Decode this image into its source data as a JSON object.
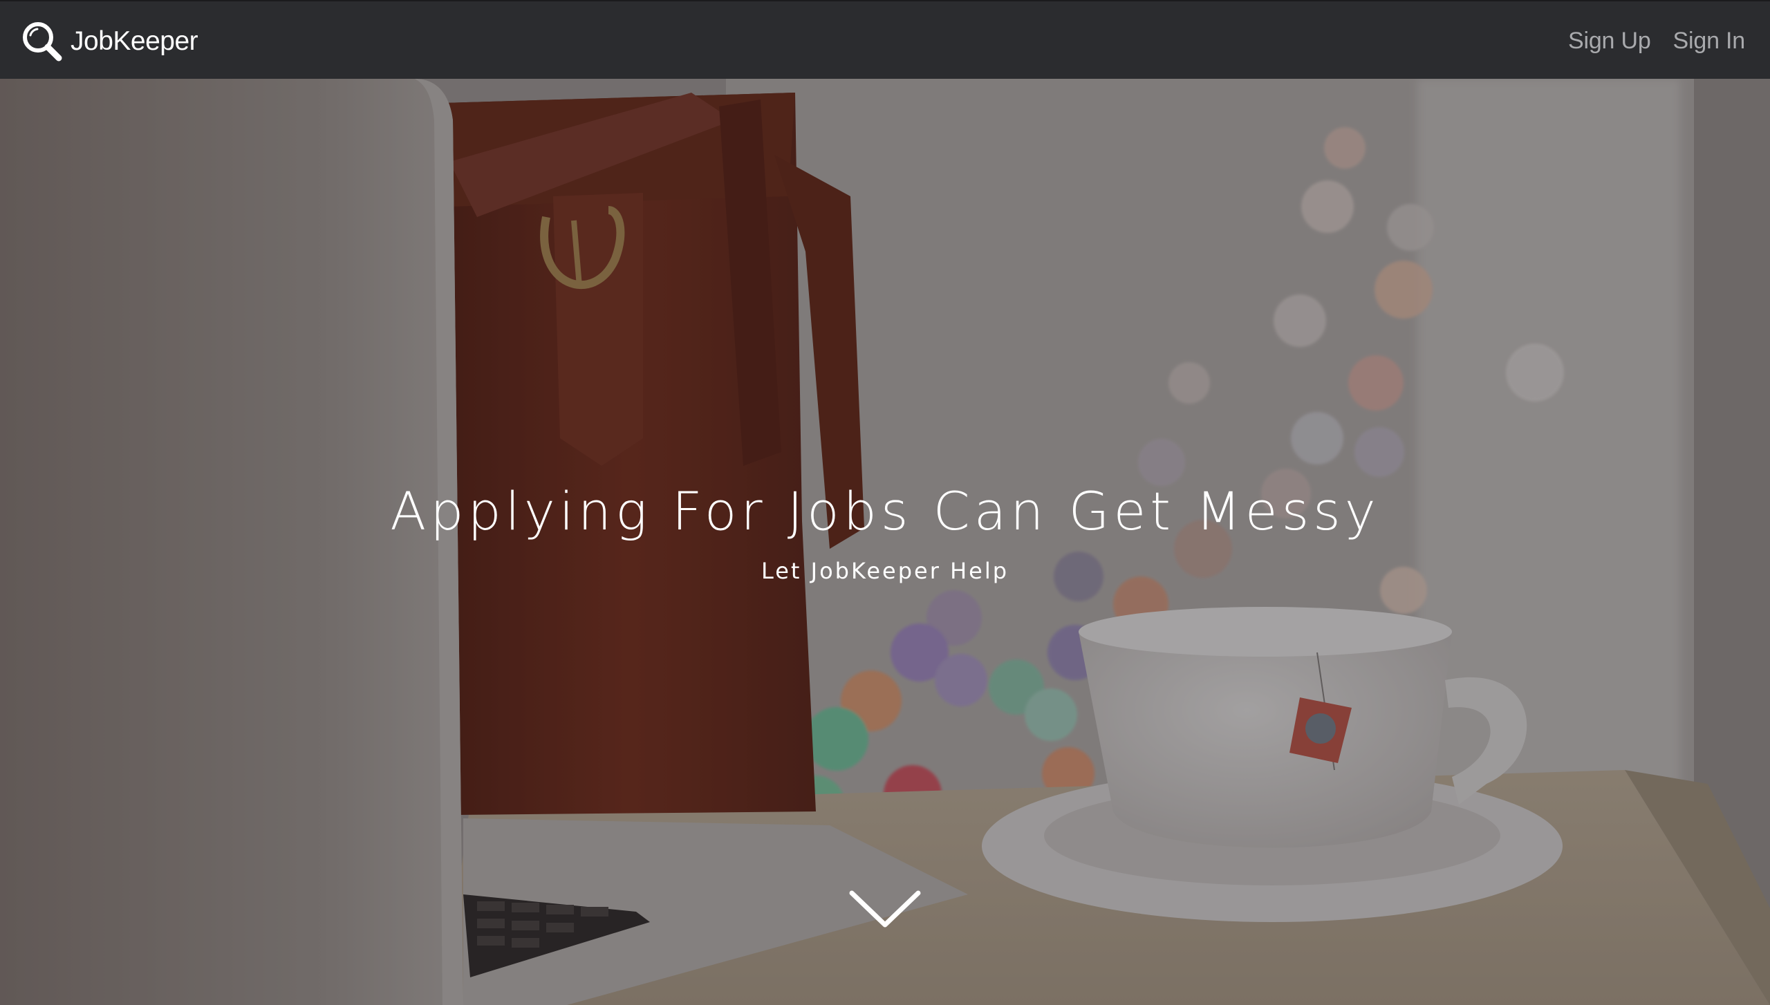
{
  "navbar": {
    "brand": {
      "name": "JobKeeper",
      "icon": "magnifier-icon"
    },
    "links": [
      {
        "label": "Sign Up"
      },
      {
        "label": "Sign In"
      }
    ]
  },
  "hero": {
    "title": "Applying For Jobs Can Get Messy",
    "subtitle": "Let JobKeeper Help",
    "scroll_icon": "chevron-down-icon",
    "background_scene": "laptop, leather bag and tea cup on a table with bokeh lights"
  },
  "colors": {
    "navbar_bg": "#2b2c2f",
    "nav_link": "#a9aaad",
    "brand_text": "#ffffff",
    "hero_text": "#ffffff"
  }
}
